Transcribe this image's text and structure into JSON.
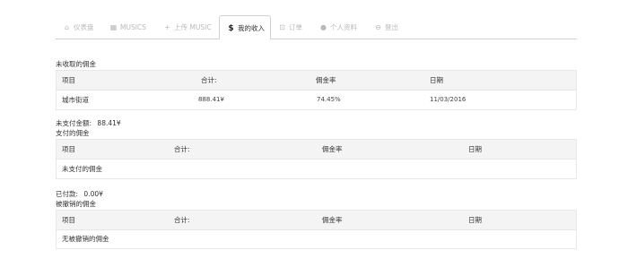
{
  "tabs": [
    {
      "icon": "⌂",
      "label": "仪表盘"
    },
    {
      "icon": "▦",
      "label": "MUSICS"
    },
    {
      "icon": "+",
      "label": "上传 MUSIC"
    },
    {
      "icon": "$",
      "label": "我的收入"
    },
    {
      "icon": "⊡",
      "label": "订单"
    },
    {
      "icon": "●",
      "label": "个人资料"
    },
    {
      "icon": "⊖",
      "label": "登出"
    }
  ],
  "uncollected": {
    "title": "未收取的佣金",
    "columns": [
      "项目",
      "合计:",
      "佣金率",
      "日期"
    ],
    "row": {
      "item": "城市街道",
      "total": "888.41¥",
      "rate": "74.45%",
      "date": "11/03/2016"
    }
  },
  "unpaid": {
    "label": "未支付金额:",
    "value": "88.41¥"
  },
  "paid_commission": {
    "title": "支付的佣金",
    "columns": [
      "项目",
      "合计:",
      "佣金率",
      "日期"
    ],
    "empty_text": "未支付的佣金"
  },
  "paid": {
    "label": "已付款:",
    "value": "0.00¥"
  },
  "revoked": {
    "title": "被撤销的佣金",
    "columns": [
      "项目",
      "合计:",
      "佣金率",
      "日期"
    ],
    "empty_text": "无被撤销的佣金"
  }
}
